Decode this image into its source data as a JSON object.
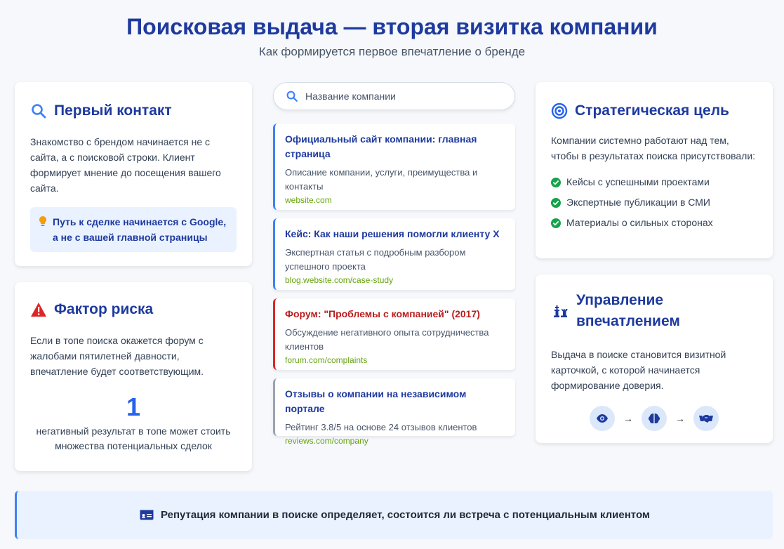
{
  "header": {
    "title": "Поисковая выдача — вторая визитка компании",
    "subtitle": "Как формируется первое впечатление о бренде"
  },
  "first_contact": {
    "icon": "search-icon",
    "title": "Первый контакт",
    "text": "Знакомство с брендом начинается не с сайта, а с поисковой строки. Клиент формирует мнение до посещения вашего сайта.",
    "tip_icon": "lightbulb-icon",
    "tip": "Путь к сделке начинается с Google, а не с вашей главной страницы"
  },
  "risk": {
    "icon": "warning-icon",
    "title": "Фактор риска",
    "text": "Если в топе поиска окажется форум с жалобами пятилетней давности, впечатление будет соответствующим.",
    "stat_value": "1",
    "stat_label": "негативный результат в топе может стоить множества потенциальных сделок"
  },
  "search": {
    "icon": "search-icon",
    "placeholder": "Название компании"
  },
  "results": [
    {
      "title": "Официальный сайт компании: главная страница",
      "desc": "Описание компании, услуги, преимущества и контакты",
      "url": "website.com",
      "tone": "positive"
    },
    {
      "title": "Кейс: Как наши решения помогли клиенту X",
      "desc": "Экспертная статья с подробным разбором успешного проекта",
      "url": "blog.website.com/case-study",
      "tone": "positive"
    },
    {
      "title": "Форум: \"Проблемы с компанией\" (2017)",
      "desc": "Обсуждение негативного опыта сотрудничества клиентов",
      "url": "forum.com/complaints",
      "tone": "negative"
    },
    {
      "title": "Отзывы о компании на независимом портале",
      "desc": "Рейтинг 3.8/5 на основе 24 отзывов клиентов",
      "url": "reviews.com/company",
      "tone": "neutral"
    }
  ],
  "goal": {
    "icon": "target-icon",
    "title": "Стратегическая цель",
    "text": "Компании системно работают над тем, чтобы в результатах поиска присутствовали:",
    "items": [
      "Кейсы с успешными проектами",
      "Экспертные публикации в СМИ",
      "Материалы о сильных сторонах"
    ]
  },
  "impression": {
    "icon": "chess-icon",
    "title": "Управление впечатлением",
    "text": "Выдача в поиске становится визитной карточкой, с которой начинается формирование доверия.",
    "flow_icons": [
      "eye-icon",
      "brain-icon",
      "handshake-icon"
    ],
    "arrow": "→"
  },
  "banner": {
    "icon": "id-card-icon",
    "text": "Репутация компании в поиске определяет, состоится ли встреча с потенциальным клиентом"
  },
  "colors": {
    "accent": "#1e3a9e",
    "link": "#2563eb",
    "url": "#65a30d",
    "negative": "#dc2626",
    "success": "#16a34a"
  }
}
